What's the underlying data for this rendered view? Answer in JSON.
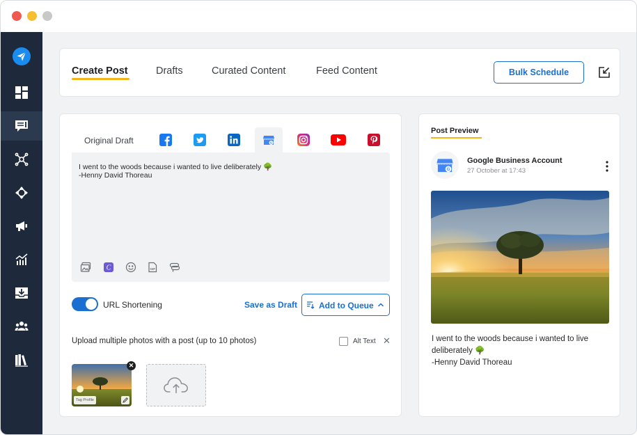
{
  "app": {
    "colors": {
      "accent": "#1a6fd0",
      "highlight": "#f2b51a",
      "sidebar": "#1e2a3c"
    }
  },
  "sidebar": {
    "items": [
      {
        "icon": "paper-plane-logo-icon"
      },
      {
        "icon": "dashboard-icon"
      },
      {
        "icon": "composer-icon",
        "active": true
      },
      {
        "icon": "network-icon"
      },
      {
        "icon": "move-arrows-icon"
      },
      {
        "icon": "megaphone-icon"
      },
      {
        "icon": "analytics-icon"
      },
      {
        "icon": "inbox-download-icon"
      },
      {
        "icon": "team-icon"
      },
      {
        "icon": "library-icon"
      }
    ]
  },
  "header": {
    "tabs": [
      {
        "label": "Create Post",
        "active": true
      },
      {
        "label": "Drafts"
      },
      {
        "label": "Curated Content"
      },
      {
        "label": "Feed Content"
      }
    ],
    "bulk_schedule": "Bulk Schedule"
  },
  "composer": {
    "original_draft": "Original Draft",
    "networks": [
      "facebook",
      "twitter",
      "linkedin",
      "google-business",
      "instagram",
      "youtube",
      "pinterest"
    ],
    "active_network": "google-business",
    "text_line1": "I went to the woods because i wanted to live deliberately 🌳",
    "text_line2": "-Henny David Thoreau",
    "url_shortening": "URL Shortening",
    "url_shortening_on": true,
    "save_draft": "Save as Draft",
    "add_to_queue": "Add to Queue",
    "upload_label": "Upload multiple photos with a post (up to 10 photos)",
    "alt_text": "Alt Text",
    "alt_close": "✕",
    "thumb_tag": "Tag Profile",
    "thumb_remove": "✕"
  },
  "preview": {
    "title": "Post Preview",
    "account_name": "Google Business Account",
    "timestamp": "27 October at 17:43",
    "text_line1": "I went to the woods because i wanted to live deliberately 🌳",
    "text_line2": "-Henny David Thoreau"
  }
}
